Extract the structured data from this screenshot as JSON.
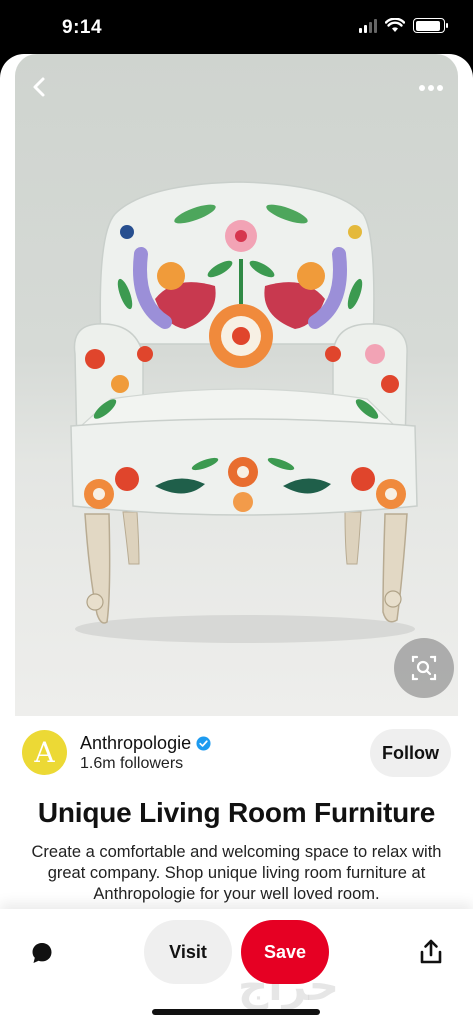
{
  "status_bar": {
    "time": "9:14",
    "signal_icon": "cellular-signal-icon",
    "wifi_icon": "wifi-icon",
    "battery_icon": "battery-icon",
    "battery_level": 0.9
  },
  "pin": {
    "image_alt": "Embroidered floral armchair",
    "back_icon": "chevron-left-icon",
    "more_icon": "more-dots-icon",
    "lens_icon": "visual-search-icon"
  },
  "author": {
    "avatar_letter": "A",
    "name": "Anthropologie",
    "verified_icon": "verified-badge-icon",
    "followers": "1.6m followers",
    "follow_label": "Follow"
  },
  "title": "Unique Living Room Furniture",
  "description": "Create a comfortable and welcoming space to relax with great company. Shop unique living room furniture at Anthropologie for your well loved room.",
  "actions": {
    "comment_icon": "comment-bubble-icon",
    "visit_label": "Visit",
    "save_label": "Save",
    "share_icon": "share-icon",
    "watermark": "حراج"
  },
  "colors": {
    "save": "#e60023",
    "avatar": "#ecd935",
    "verified": "#1d9bf0"
  }
}
